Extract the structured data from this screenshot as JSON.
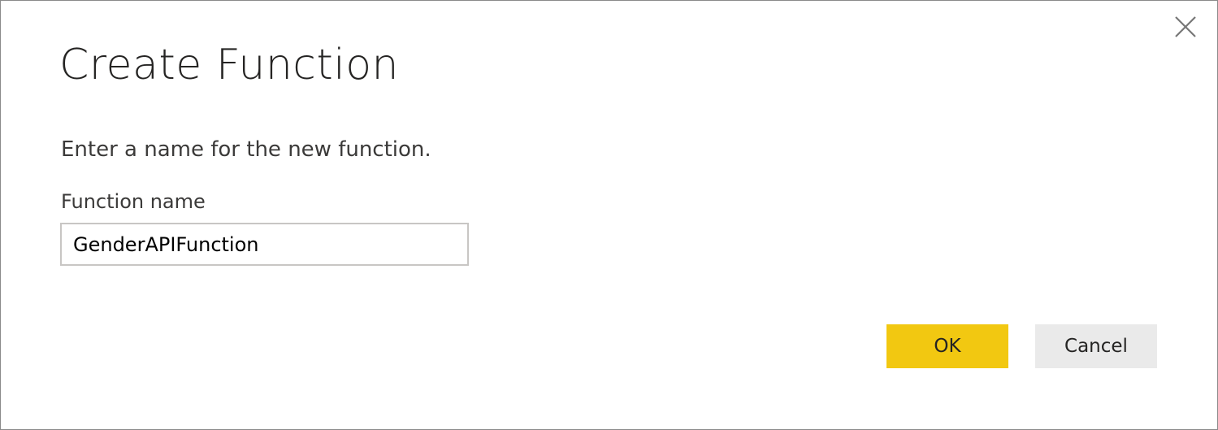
{
  "dialog": {
    "title": "Create Function",
    "prompt": "Enter a name for the new function.",
    "field_label": "Function name",
    "field_value": "GenderAPIFunction",
    "ok_label": "OK",
    "cancel_label": "Cancel",
    "close_icon": "close-icon"
  },
  "colors": {
    "ok_button": "#f2c811",
    "cancel_button": "#eaeaea",
    "border": "#8a8a8a"
  }
}
